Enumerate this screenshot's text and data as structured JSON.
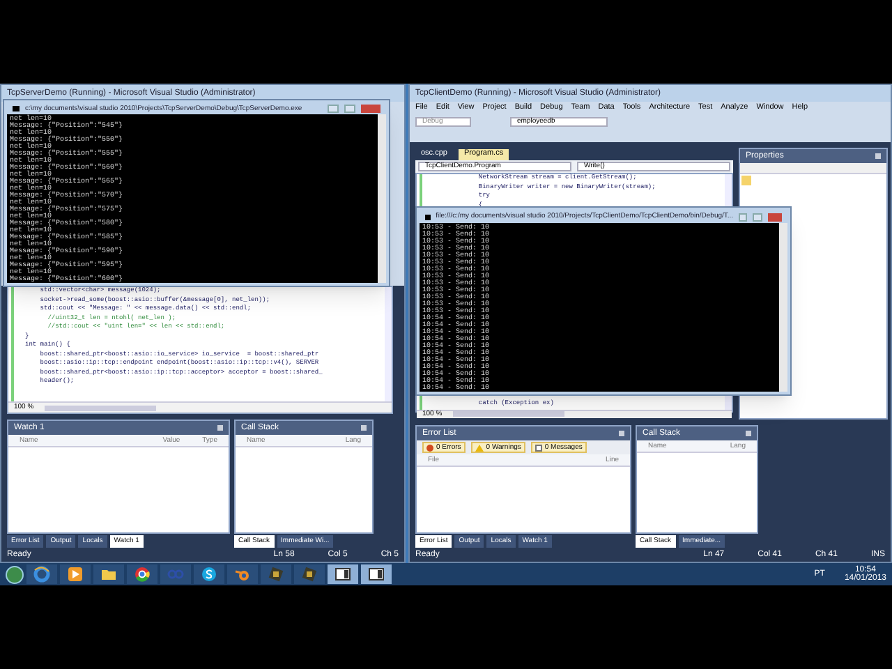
{
  "server_ide": {
    "title": "TcpServerDemo (Running) - Microsoft Visual Studio (Administrator)",
    "code_lines": [
      {
        "text": "    std::vector<char> message(1024);",
        "kind": "code"
      },
      {
        "text": "    socket->read_some(boost::asio::buffer(&message[0], net_len));",
        "kind": "code"
      },
      {
        "text": "    std::cout << \"Message: \" << message.data() << std::endl;",
        "kind": "code"
      },
      {
        "text": "      //uint32_t len = ntohl( net_len );",
        "kind": "comment"
      },
      {
        "text": "      //std::cout << \"uint len=\" << len << std::endl;",
        "kind": "comment"
      },
      {
        "text": "}",
        "kind": "code"
      },
      {
        "text": "int main() {",
        "kind": "code"
      },
      {
        "text": "    boost::shared_ptr<boost::asio::io_service> io_service  = boost::shared_ptr",
        "kind": "code"
      },
      {
        "text": "    boost::asio::ip::tcp::endpoint endpoint(boost::asio::ip::tcp::v4(), SERVER",
        "kind": "code"
      },
      {
        "text": "    boost::shared_ptr<boost::asio::ip::tcp::acceptor> acceptor = boost::shared_",
        "kind": "code"
      },
      {
        "text": "    header();",
        "kind": "code"
      }
    ],
    "zoom": "100 %",
    "watch": {
      "title": "Watch 1",
      "columns": [
        "Name",
        "Value",
        "Type"
      ]
    },
    "call_stack": {
      "title": "Call Stack",
      "columns": [
        "Name",
        "Lang"
      ]
    },
    "bottom_tabs": [
      {
        "label": "Error List",
        "selected": false
      },
      {
        "label": "Output",
        "selected": false
      },
      {
        "label": "Locals",
        "selected": false
      },
      {
        "label": "Watch 1",
        "selected": true
      }
    ],
    "side_tabs": [
      {
        "label": "Call Stack",
        "selected": true
      },
      {
        "label": "Immediate Wi...",
        "selected": false
      }
    ],
    "status": [
      "Ready",
      "Ln 58",
      "Col 5",
      "Ch 5"
    ]
  },
  "server_console": {
    "title": "c:\\my documents\\visual studio 2010\\Projects\\TcpServerDemo\\Debug\\TcpServerDemo.exe",
    "lines": [
      "net len=10",
      "Message: {\"Position\":\"545\"}",
      "net len=10",
      "Message: {\"Position\":\"550\"}",
      "net len=10",
      "Message: {\"Position\":\"555\"}",
      "net len=10",
      "Message: {\"Position\":\"560\"}",
      "net len=10",
      "Message: {\"Position\":\"565\"}",
      "net len=10",
      "Message: {\"Position\":\"570\"}",
      "net len=10",
      "Message: {\"Position\":\"575\"}",
      "net len=10",
      "Message: {\"Position\":\"580\"}",
      "net len=10",
      "Message: {\"Position\":\"585\"}",
      "net len=10",
      "Message: {\"Position\":\"590\"}",
      "net len=10",
      "Message: {\"Position\":\"595\"}",
      "net len=10",
      "Message: {\"Position\":\"600\"}"
    ]
  },
  "client_ide": {
    "title": "TcpClientDemo (Running) - Microsoft Visual Studio (Administrator)",
    "menu": [
      "File",
      "Edit",
      "View",
      "Project",
      "Build",
      "Debug",
      "Team",
      "Data",
      "Tools",
      "Architecture",
      "Test",
      "Analyze",
      "Window",
      "Help"
    ],
    "config": "Debug",
    "database": "employeedb",
    "doc_tabs": [
      {
        "label": "osc.cpp",
        "selected": false
      },
      {
        "label": "Program.cs",
        "selected": true
      }
    ],
    "type_combo": "TcpClientDemo.Program",
    "member_combo": "Write()",
    "code_lines": [
      {
        "text": "            NetworkStream stream = client.GetStream();",
        "kind": "code"
      },
      {
        "text": "            BinaryWriter writer = new BinaryWriter(stream);",
        "kind": "code"
      },
      {
        "text": "            try",
        "kind": "code"
      },
      {
        "text": "            {",
        "kind": "code"
      }
    ],
    "code_after": [
      {
        "text": "            catch (Exception ex)",
        "kind": "code"
      }
    ],
    "zoom": "100 %",
    "properties": {
      "title": "Properties"
    },
    "error_list": {
      "title": "Error List",
      "filters": [
        {
          "label": "0 Errors",
          "kind": "error"
        },
        {
          "label": "0 Warnings",
          "kind": "warning"
        },
        {
          "label": "0 Messages",
          "kind": "message"
        }
      ],
      "columns": [
        "File",
        "Line"
      ]
    },
    "call_stack": {
      "title": "Call Stack",
      "columns": [
        "Name",
        "Lang"
      ]
    },
    "bottom_tabs": [
      {
        "label": "Error List",
        "selected": true
      },
      {
        "label": "Output",
        "selected": false
      },
      {
        "label": "Locals",
        "selected": false
      },
      {
        "label": "Watch 1",
        "selected": false
      }
    ],
    "side_tabs": [
      {
        "label": "Call Stack",
        "selected": true
      },
      {
        "label": "Immediate...",
        "selected": false
      }
    ],
    "status": [
      "Ready",
      "Ln 47",
      "Col 41",
      "Ch 41",
      "INS"
    ]
  },
  "client_console": {
    "title": "file:///c:/my documents/visual studio 2010/Projects/TcpClientDemo/TcpClientDemo/bin/Debug/T...",
    "lines": [
      "10:53 - Send: 10",
      "10:53 - Send: 10",
      "10:53 - Send: 10",
      "10:53 - Send: 10",
      "10:53 - Send: 10",
      "10:53 - Send: 10",
      "10:53 - Send: 10",
      "10:53 - Send: 10",
      "10:53 - Send: 10",
      "10:53 - Send: 10",
      "10:53 - Send: 10",
      "10:53 - Send: 10",
      "10:53 - Send: 10",
      "10:54 - Send: 10",
      "10:54 - Send: 10",
      "10:54 - Send: 10",
      "10:54 - Send: 10",
      "10:54 - Send: 10",
      "10:54 - Send: 10",
      "10:54 - Send: 10",
      "10:54 - Send: 10",
      "10:54 - Send: 10",
      "10:54 - Send: 10",
      "10:54 - Send: 10"
    ]
  },
  "taskbar": {
    "apps": [
      {
        "kind": "ie",
        "open": false
      },
      {
        "kind": "media",
        "open": false
      },
      {
        "kind": "folder",
        "open": false
      },
      {
        "kind": "chrome",
        "open": false
      },
      {
        "kind": "glasses",
        "open": false
      },
      {
        "kind": "skype",
        "open": false
      },
      {
        "kind": "blender",
        "open": false
      },
      {
        "kind": "chip",
        "open": false
      },
      {
        "kind": "chip",
        "open": false
      },
      {
        "kind": "window",
        "open": true
      },
      {
        "kind": "window",
        "open": true
      }
    ],
    "language": "PT",
    "time": "10:54",
    "date": "14/01/2013"
  }
}
